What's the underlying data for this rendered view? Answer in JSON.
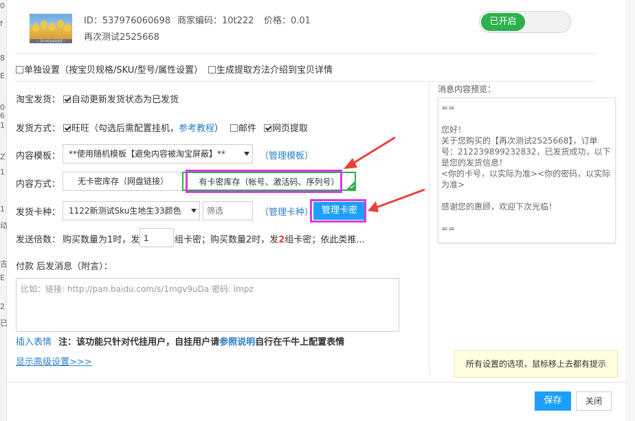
{
  "bg_left_chars": [
    "0",
    "f",
    "8",
    "E",
    "0",
    "6",
    "1",
    "Z",
    "1",
    "1",
    "动",
    "吉",
    "E",
    "2",
    "已"
  ],
  "product": {
    "thumb_caption": "···· 24小时全自动发货 ···",
    "id_text": "ID：537976060698",
    "merchant_code": "商家编码：10t222",
    "price": "价格：0.01",
    "name": "再次测试2525668",
    "toggle_label": "已开启"
  },
  "options": {
    "separate_setting": "单独设置（按宝贝规格/SKU/型号/属性设置）",
    "generate_method": "生成提取方法介绍到宝贝详情"
  },
  "form": {
    "taobao_ship_label": "淘宝发货：",
    "auto_update_label": "自动更新发货状态为已发货",
    "ship_method_label": "发货方式：",
    "wangwang_label": "旺旺（勾选后需配置挂机，",
    "tutorial_link": "参考教程",
    "tutorial_close": "）",
    "email_label": "邮件",
    "web_extract_label": "网页提取",
    "template_label": "内容模板：",
    "template_value": "**使用随机模板【避免内容被淘宝屏蔽】**",
    "manage_template_open": "（",
    "manage_template_link": "管理模板",
    "manage_template_close": "）",
    "content_method_label": "内容方式：",
    "tab_no_card": "无卡密库存（网盘链接）",
    "tab_card": "有卡密库存（帐号、激活码、序列号）",
    "card_type_label": "发货卡种：",
    "card_type_value": "1122新测试Sku生地生33颜色",
    "filter_placeholder": "筛选",
    "manage_cardtype_open": "（",
    "manage_cardtype_link": "管理卡种",
    "manage_cardtype_close": "）",
    "manage_card_button": "管理卡密",
    "multiple_label": "发送倍数：",
    "multiple_pre": "购买数量为1时，发",
    "multiple_value": "1",
    "multiple_mid": "组卡密；购买数量2时，发",
    "multiple_num": "2",
    "multiple_post": "组卡密；依此类推...",
    "after_pay_label": "付款 后发消息（附言）：",
    "textarea_placeholder": "比如：链接: http://pan.baidu.com/s/1mgv9uDa 密码: lmpz",
    "insert_emoji": "插入表情",
    "note_pre": "注：该功能只针对代挂用户，自挂用户请",
    "note_link": "参照说明",
    "note_post": "自行在千牛上配置表情",
    "show_advanced": "显示高级设置>>>"
  },
  "preview": {
    "title": "消息内容预览：",
    "lines": [
      "==",
      "",
      "您好！",
      "关于您购买的【再次测试2525668】，订单号：212239899232832，已发货成功，以下是您的发货信息！",
      "<你的卡号，以实际为准><你的密码，以实际为准>",
      "",
      "感谢您的惠顾，欢迎下次光临！",
      "",
      "=="
    ],
    "tip": "所有设置的选项，鼠标移上去都有提示"
  },
  "footer": {
    "save": "保存",
    "close": "关闭"
  },
  "colors": {
    "toggle_green": "#2bb24c",
    "primary_blue": "#1e9fff",
    "highlight_magenta": "#d63be2",
    "arrow_red": "#e8403a",
    "link_blue": "#2a7ec8",
    "accent_red": "#e8403a"
  }
}
